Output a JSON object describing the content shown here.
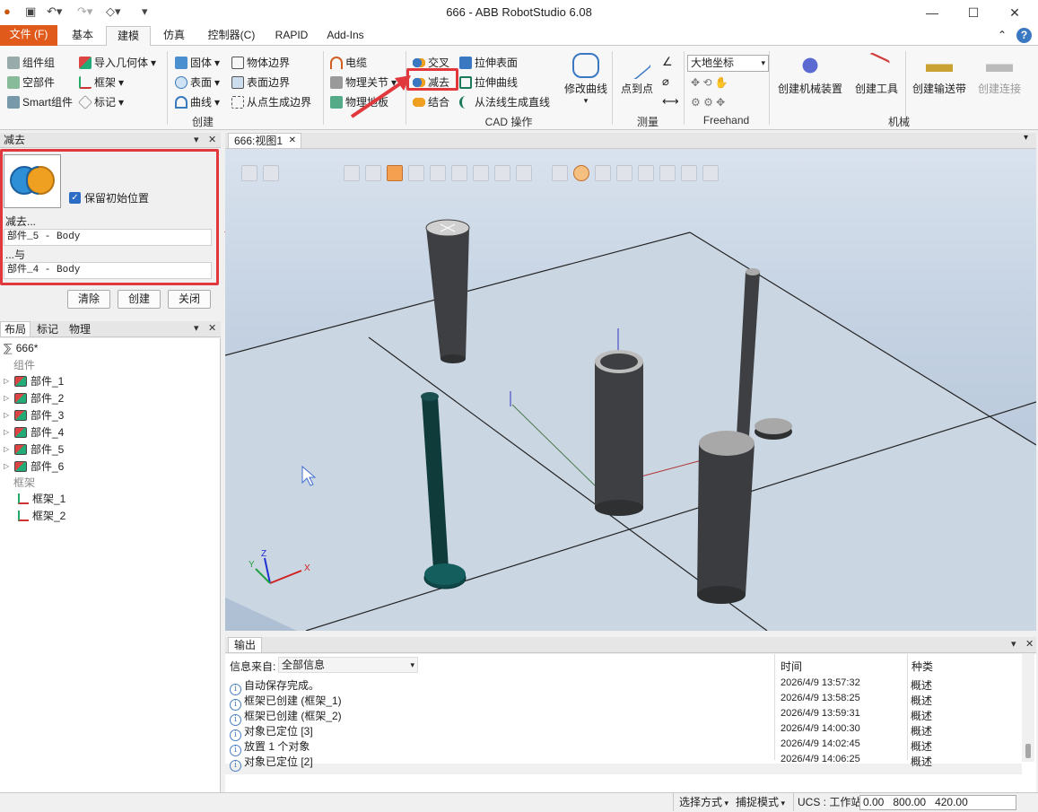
{
  "window": {
    "title": "666 - ABB RobotStudio 6.08"
  },
  "tabs": [
    {
      "label": "文件 (F)"
    },
    {
      "label": "基本"
    },
    {
      "label": "建模"
    },
    {
      "label": "仿真"
    },
    {
      "label": "控制器(C)"
    },
    {
      "label": "RAPID"
    },
    {
      "label": "Add-Ins"
    }
  ],
  "ribbon": {
    "create": {
      "group_label": "创建",
      "component_group": "组件组",
      "empty_part": "空部件",
      "smart_component": "Smart组件",
      "import_geometry": "导入几何体",
      "frame": "框架",
      "mark": "标记",
      "solid": "固体",
      "surface": "表面",
      "curve": "曲线",
      "object_border": "物体边界",
      "surface_border": "表面边界",
      "border_from_points": "从点生成边界",
      "cable": "电缆",
      "physics_joint": "物理关节",
      "physics_base": "物理地板"
    },
    "cad": {
      "group_label": "CAD 操作",
      "intersect": "交叉",
      "subtract": "减去",
      "union": "结合",
      "extrude_surface": "拉伸表面",
      "extrude_curve": "拉伸曲线",
      "line_from_normal": "从法线生成直线",
      "modify_curve": "修改曲线"
    },
    "measure": {
      "group_label": "测量",
      "point_to_point": "点到点"
    },
    "freehand": {
      "group_label": "Freehand",
      "coord_select": "大地坐标"
    },
    "mechanism": {
      "group_label": "机械",
      "create_mechanism": "创建机械装置",
      "create_tool": "创建工具",
      "create_conveyor": "创建输送带",
      "create_connection": "创建连接"
    }
  },
  "subtract_panel": {
    "title": "减去",
    "keep_original_label": "保留初始位置",
    "keep_original_checked": true,
    "subtract_label": "减去...",
    "subtract_value": "部件_5 - Body",
    "with_label": "...与",
    "with_value": "部件_4 - Body",
    "clear_button": "清除",
    "create_button": "创建",
    "close_button": "关闭"
  },
  "layout_panel": {
    "tabs": [
      "布局",
      "标记",
      "物理"
    ],
    "station": "666*",
    "components_header": "组件",
    "parts": [
      "部件_1",
      "部件_2",
      "部件_3",
      "部件_4",
      "部件_5",
      "部件_6"
    ],
    "frames_header": "框架",
    "frames": [
      "框架_1",
      "框架_2"
    ]
  },
  "view": {
    "tab_label": "666:视图1"
  },
  "output": {
    "title": "输出",
    "filter_label": "信息来自:",
    "filter_value": "全部信息",
    "col_time": "时间",
    "col_type": "种类",
    "rows": [
      {
        "msg": "自动保存完成。",
        "time": "2026/4/9 13:57:32",
        "type": "概述"
      },
      {
        "msg": "框架已创建 (框架_1)",
        "time": "2026/4/9 13:58:25",
        "type": "概述"
      },
      {
        "msg": "框架已创建 (框架_2)",
        "time": "2026/4/9 13:59:31",
        "type": "概述"
      },
      {
        "msg": "对象已定位 [3]",
        "time": "2026/4/9 14:00:30",
        "type": "概述"
      },
      {
        "msg": "放置 1 个对象",
        "time": "2026/4/9 14:02:45",
        "type": "概述"
      },
      {
        "msg": "对象已定位 [2]",
        "time": "2026/4/9 14:06:25",
        "type": "概述"
      }
    ]
  },
  "statusbar": {
    "select_mode": "选择方式",
    "snap_mode": "捕捉模式",
    "ucs": "UCS : 工作站",
    "coords": "0.00   800.00   420.00"
  },
  "colors": {
    "file_tab": "#e05a1c",
    "highlight": "#e0383c",
    "accent": "#3a78c2"
  }
}
